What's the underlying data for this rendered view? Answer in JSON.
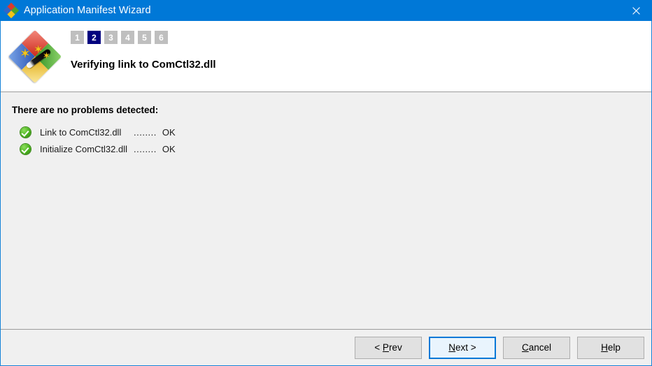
{
  "window": {
    "title": "Application Manifest Wizard",
    "icon": "app-diamond-icon",
    "close_label": "✕",
    "accent_color": "#0078d7",
    "body_color": "#f0f0f0"
  },
  "header": {
    "logo": "wizard-magic-wand-icon",
    "steps": [
      {
        "label": "1",
        "active": false
      },
      {
        "label": "2",
        "active": true
      },
      {
        "label": "3",
        "active": false
      },
      {
        "label": "4",
        "active": false
      },
      {
        "label": "5",
        "active": false
      },
      {
        "label": "6",
        "active": false
      }
    ],
    "active_step": "2",
    "active_step_color": "#00007f",
    "inactive_step_color": "#bfbfbf",
    "title": "Verifying link to ComCtl32.dll"
  },
  "main": {
    "heading": "There are no problems detected:",
    "checks": [
      {
        "icon": "green-check-icon",
        "label": "Link to ComCtl32.dll",
        "dots": "........",
        "status": "OK"
      },
      {
        "icon": "green-check-icon",
        "label": "Initialize ComCtl32.dll",
        "dots": "........",
        "status": "OK"
      }
    ],
    "check_color": "#49b21c"
  },
  "footer": {
    "buttons": [
      {
        "id": "prev",
        "pre": "< ",
        "acc": "P",
        "post": "rev",
        "default": false
      },
      {
        "id": "next",
        "pre": "",
        "acc": "N",
        "post": "ext >",
        "default": true
      },
      {
        "id": "cancel",
        "pre": "",
        "acc": "C",
        "post": "ancel",
        "default": false
      },
      {
        "id": "help",
        "pre": "",
        "acc": "H",
        "post": "elp",
        "default": false
      }
    ]
  }
}
